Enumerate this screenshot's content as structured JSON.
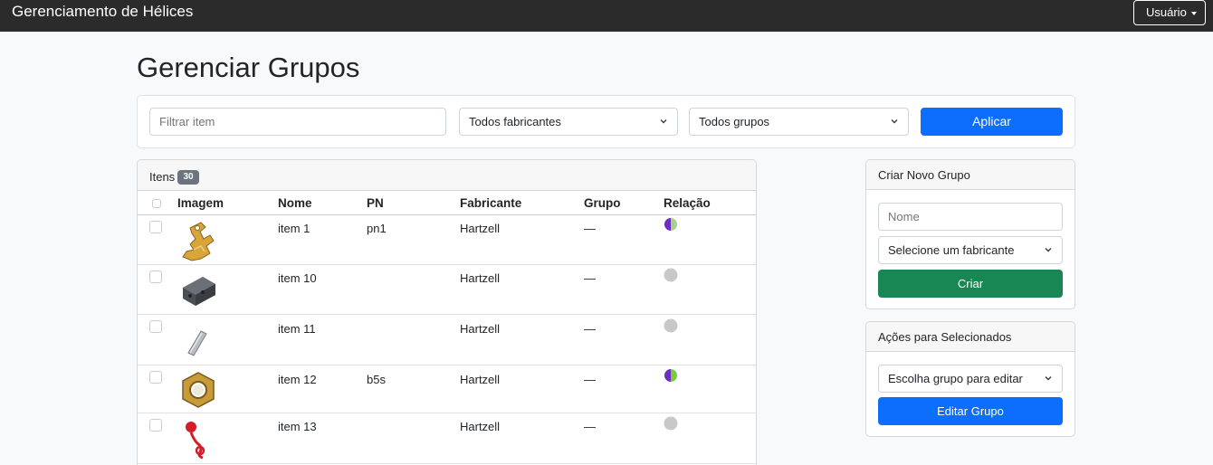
{
  "app": {
    "title": "Gerenciamento de Hélices",
    "user_menu": "Usuário"
  },
  "page": {
    "title": "Gerenciar Grupos"
  },
  "filters": {
    "search_placeholder": "Filtrar item",
    "manufacturer_selected": "Todos fabricantes",
    "group_selected": "Todos grupos",
    "apply_label": "Aplicar"
  },
  "items": {
    "title": "Itens",
    "count": "30",
    "columns": {
      "image": "Imagem",
      "name": "Nome",
      "pn": "PN",
      "manufacturer": "Fabricante",
      "group": "Grupo",
      "relation": "Relação"
    },
    "rows": [
      {
        "name": "item 1",
        "pn": "pn1",
        "manufacturer": "Hartzell",
        "group": "—",
        "image_icon": "brass-bracket-icon",
        "relation": "split-purple-green"
      },
      {
        "name": "item 10",
        "pn": "",
        "manufacturer": "Hartzell",
        "group": "—",
        "image_icon": "gray-block-icon",
        "relation": "gray"
      },
      {
        "name": "item 11",
        "pn": "",
        "manufacturer": "Hartzell",
        "group": "—",
        "image_icon": "metal-pin-icon",
        "relation": "gray"
      },
      {
        "name": "item 12",
        "pn": "b5s",
        "manufacturer": "Hartzell",
        "group": "—",
        "image_icon": "hex-nut-icon",
        "relation": "split-purple-green"
      },
      {
        "name": "item 13",
        "pn": "",
        "manufacturer": "Hartzell",
        "group": "—",
        "image_icon": "red-cap-icon",
        "relation": "gray"
      }
    ]
  },
  "create_group": {
    "title": "Criar Novo Grupo",
    "name_placeholder": "Nome",
    "manufacturer_placeholder": "Selecione um fabricante",
    "create_label": "Criar"
  },
  "bulk_actions": {
    "title": "Ações para Selecionados",
    "group_placeholder": "Escolha grupo para editar",
    "edit_label": "Editar Grupo"
  },
  "colors": {
    "navbar": "#2b2b2b",
    "primary": "#0d6efd",
    "success": "#198754",
    "relation_purple": "#6f2dbd",
    "relation_green": "#a8d08d",
    "relation_gray": "#c8c8c8"
  }
}
